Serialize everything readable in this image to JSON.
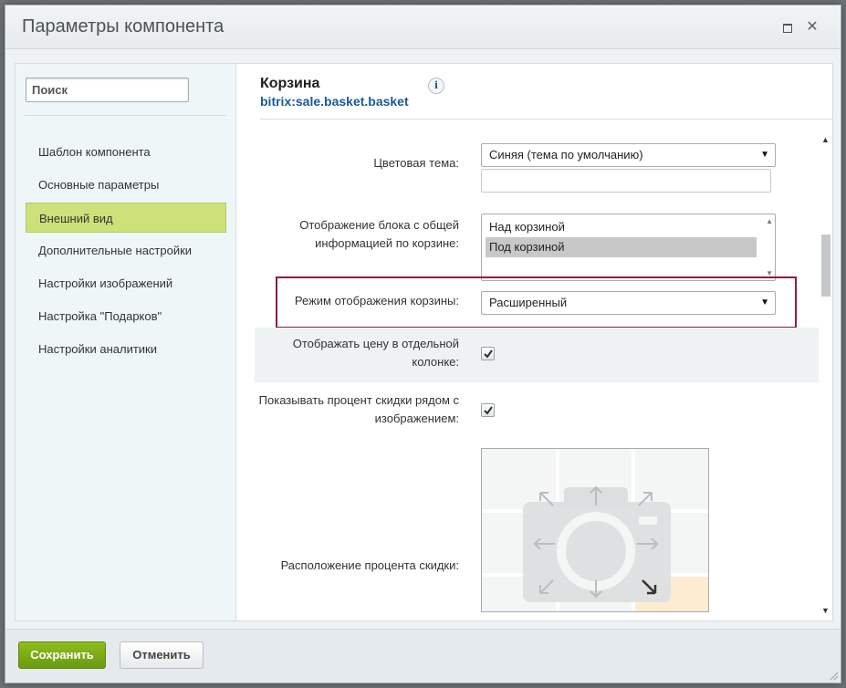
{
  "dialog": {
    "title": "Параметры компонента",
    "maximize_icon": "maximize-icon",
    "close_icon": "close-icon",
    "close_glyph": "✕"
  },
  "sidebar": {
    "search_placeholder": "Поиск",
    "items": [
      {
        "label": "Шаблон компонента",
        "active": false
      },
      {
        "label": "Основные параметры",
        "active": false
      },
      {
        "label": "Внешний вид",
        "active": true
      },
      {
        "label": "Дополнительные настройки",
        "active": false
      },
      {
        "label": "Настройки изображений",
        "active": false
      },
      {
        "label": "Настройка \"Подарков\"",
        "active": false
      },
      {
        "label": "Настройки аналитики",
        "active": false
      }
    ]
  },
  "component": {
    "name": "Корзина",
    "code": "bitrix:sale.basket.basket",
    "info_glyph": "i"
  },
  "fields": {
    "color_theme": {
      "label": "Цветовая тема:",
      "value": "Синяя (тема по умолчанию)",
      "custom_value": ""
    },
    "total_block": {
      "label_line1": "Отображение блока с общей",
      "label_line2": "информацией по корзине:",
      "options": [
        "Над корзиной",
        "Под корзиной"
      ],
      "selected": "Под корзиной"
    },
    "display_mode": {
      "label": "Режим отображения корзины:",
      "value": "Расширенный"
    },
    "price_column": {
      "label_line1": "Отображать цену в отдельной",
      "label_line2": "колонке:",
      "checked": true
    },
    "discount_percent": {
      "label_line1": "Показывать процент скидки рядом с",
      "label_line2": "изображением:",
      "checked": true
    },
    "discount_position": {
      "label": "Расположение процента скидки:",
      "selected": "bottom-right"
    }
  },
  "colors": {
    "sidebar_active": "#cde07a",
    "highlight_border": "#8b1e3f",
    "save_button": "#7aab14",
    "link": "#1a5a94",
    "position_active": "#fdecd2"
  },
  "footer": {
    "save_label": "Сохранить",
    "cancel_label": "Отменить"
  }
}
